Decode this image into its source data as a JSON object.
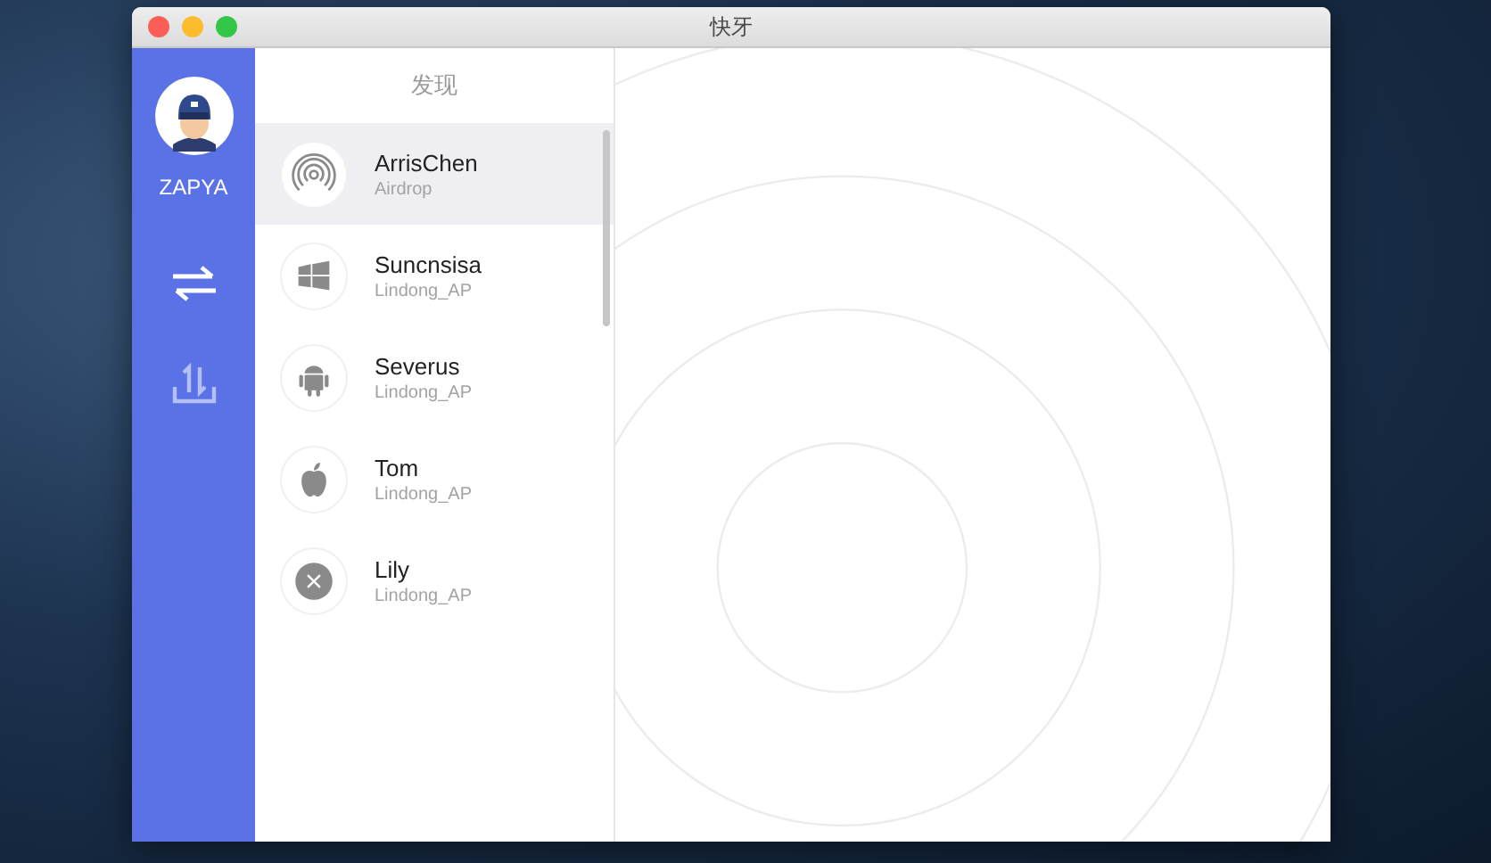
{
  "window": {
    "title": "快牙"
  },
  "sidebar": {
    "user": {
      "name": "ZAPYA"
    },
    "items": [
      {
        "kind": "transfer",
        "selected": true
      },
      {
        "kind": "upload",
        "selected": false
      }
    ]
  },
  "device_list": {
    "title": "发现",
    "devices": [
      {
        "kind": "airdrop",
        "name": "ArrisChen",
        "network": "Airdrop",
        "selected": true
      },
      {
        "kind": "windows",
        "name": "Suncnsisa",
        "network": "Lindong_AP",
        "selected": false
      },
      {
        "kind": "android",
        "name": "Severus",
        "network": "Lindong_AP",
        "selected": false
      },
      {
        "kind": "apple",
        "name": "Tom",
        "network": "Lindong_AP",
        "selected": false
      },
      {
        "kind": "x",
        "name": "Lily",
        "network": "Lindong_AP",
        "selected": false
      }
    ]
  }
}
